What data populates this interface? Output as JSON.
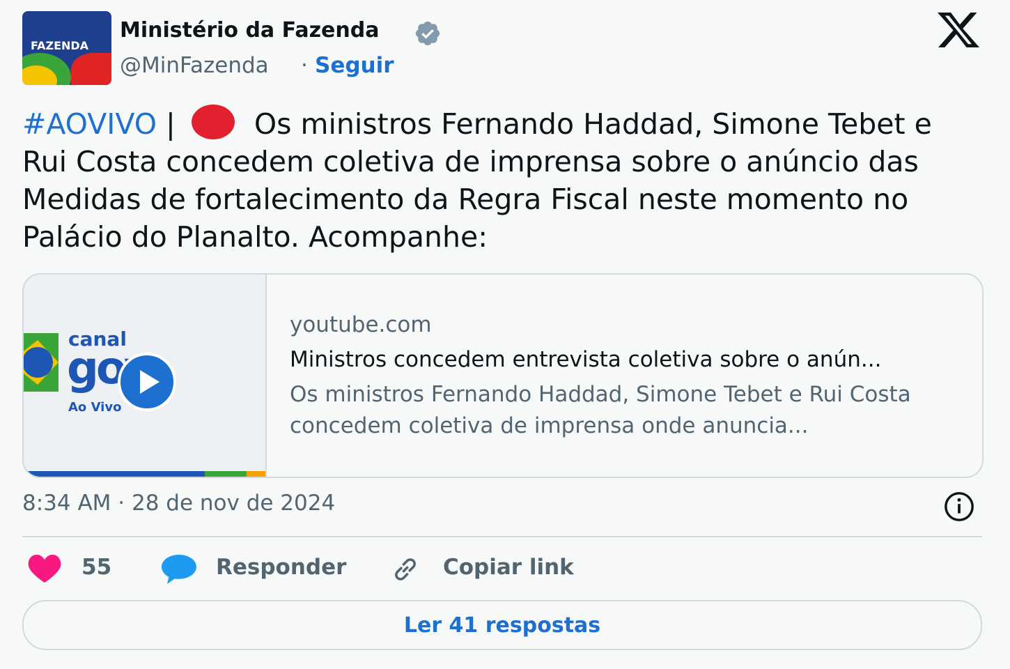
{
  "author": {
    "name": "Ministério da Fazenda",
    "handle": "@MinFazenda",
    "separator": "·",
    "follow_label": "Seguir",
    "avatar_text": "FAZENDA"
  },
  "tweet": {
    "hashtag": "#AOVIVO",
    "pipe": "|",
    "text": "Os ministros Fernando Haddad, Simone Tebet e Rui Costa concedem coletiva de imprensa sobre o anúncio das Medidas de fortalecimento da Regra Fiscal neste momento no Palácio do Planalto. Acompanhe:"
  },
  "card": {
    "thumb_canal": "canal",
    "thumb_gov": "gov",
    "thumb_aovivo": "Ao Vivo",
    "domain": "youtube.com",
    "title": "Ministros concedem entrevista coletiva sobre o anún...",
    "description": "Os ministros Fernando Haddad, Simone Tebet e Rui Costa concedem coletiva de imprensa onde anuncia..."
  },
  "meta": {
    "timestamp": "8:34 AM · 28 de nov de 2024"
  },
  "actions": {
    "likes": "55",
    "reply_label": "Responder",
    "copy_label": "Copiar link",
    "read_replies_label": "Ler 41 respostas"
  },
  "colors": {
    "accent": "#1d6fd0",
    "live_dot": "#e2202f",
    "heart": "#f91880",
    "reply_bubble": "#1d9bf0"
  }
}
